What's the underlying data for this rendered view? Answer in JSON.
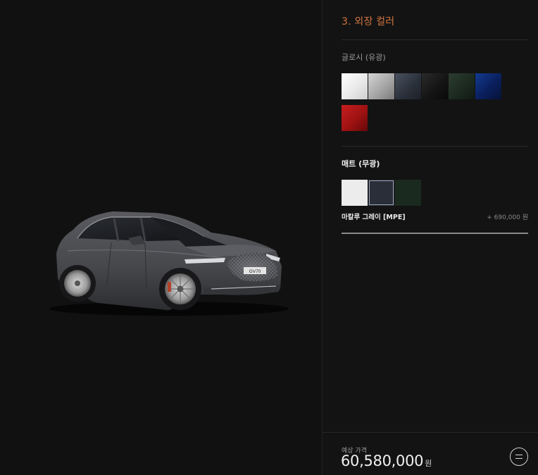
{
  "configurator": {
    "section_title": "3. 외장 컬러",
    "glossy": {
      "label": "글로시 (유광)",
      "swatches": [
        {
          "name": "white",
          "color": "#f1f1f1"
        },
        {
          "name": "silver",
          "color": "#a9a9a9"
        },
        {
          "name": "dark-gray",
          "color": "#2f3540"
        },
        {
          "name": "black",
          "color": "#141414"
        },
        {
          "name": "dark-green",
          "color": "#1c2a20"
        },
        {
          "name": "navy",
          "color": "#0a1f5c"
        },
        {
          "name": "red",
          "color": "#9e1212"
        }
      ]
    },
    "matte": {
      "label": "매트 (무광)",
      "swatches": [
        {
          "name": "matte-white",
          "color": "#ececec"
        },
        {
          "name": "matte-gray",
          "color": "#2a2e38"
        },
        {
          "name": "matte-green",
          "color": "#1b2a1f"
        }
      ],
      "selected_index": 1
    },
    "selected_color": {
      "name": "마칼루 그레이 [MPE]",
      "price": "+ 690,000 원"
    },
    "footer": {
      "price_label": "예상 가격",
      "price_value": "60,580,000",
      "price_unit": "원"
    }
  },
  "car": {
    "badge": "GV70",
    "body_color": "#4a4b4f"
  }
}
